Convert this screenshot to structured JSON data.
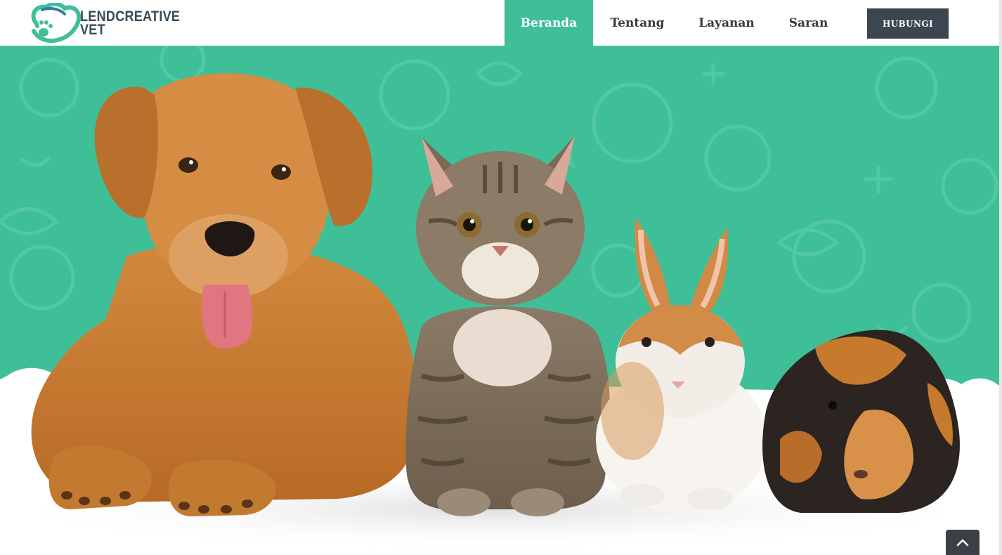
{
  "brand": {
    "line1": "LENDCREATIVE",
    "line2": "VET",
    "logo_icon": "paw-heart-icon"
  },
  "nav": {
    "items": [
      {
        "label": "Beranda",
        "active": true
      },
      {
        "label": "Tentang",
        "active": false
      },
      {
        "label": "Layanan",
        "active": false
      },
      {
        "label": "Saran",
        "active": false
      }
    ],
    "cta_label": "HUBUNGI"
  },
  "hero": {
    "background_color": "#3fbf98",
    "pattern_color": "#53c9a5",
    "animals": [
      "dog",
      "cat",
      "rabbit",
      "guinea-pig"
    ]
  },
  "back_to_top_icon": "chevron-up-icon",
  "colors": {
    "accent": "#3fbf98",
    "dark": "#3d4550",
    "text": "#3a3a3a"
  }
}
